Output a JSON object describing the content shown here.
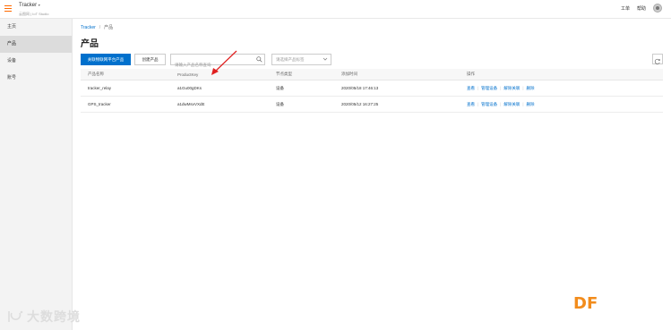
{
  "header": {
    "app_title": "Tracker",
    "app_subtitle": "云图网 | IoT Studio",
    "links": [
      "工单",
      "帮助"
    ]
  },
  "sidebar": {
    "items": [
      {
        "label": "主页",
        "active": false
      },
      {
        "label": "产品",
        "active": true
      },
      {
        "label": "设备",
        "active": false
      },
      {
        "label": "账号",
        "active": false
      }
    ]
  },
  "breadcrumb": {
    "root": "Tracker",
    "sep": "/",
    "current": "产品"
  },
  "page_title": "产品",
  "toolbar": {
    "import_label": "关联物联网平台产品",
    "create_label": "创建产品",
    "search_placeholder": "请输入产品名称查询",
    "select_placeholder": "请选择产品标签"
  },
  "table": {
    "headers": [
      "产品名称",
      "ProductKey",
      "节点类型",
      "添加时间",
      "操作"
    ],
    "rows": [
      {
        "name": "tracker_relay",
        "key": "a1Gu00gDKs",
        "node": "设备",
        "time": "2020/05/18 17:46:13"
      },
      {
        "name": "GPS_tracker",
        "key": "a1dwMsvVXdE",
        "node": "设备",
        "time": "2020/05/12 16:27:25"
      }
    ],
    "actions": [
      "查看",
      "管理设备",
      "解除关联",
      "删除"
    ]
  },
  "watermark": {
    "left_text": "大数跨境",
    "right_text": "DF"
  },
  "colors": {
    "accent": "#0070cc",
    "brand_orange": "#ff6a00",
    "arrow_red": "#e02020"
  }
}
